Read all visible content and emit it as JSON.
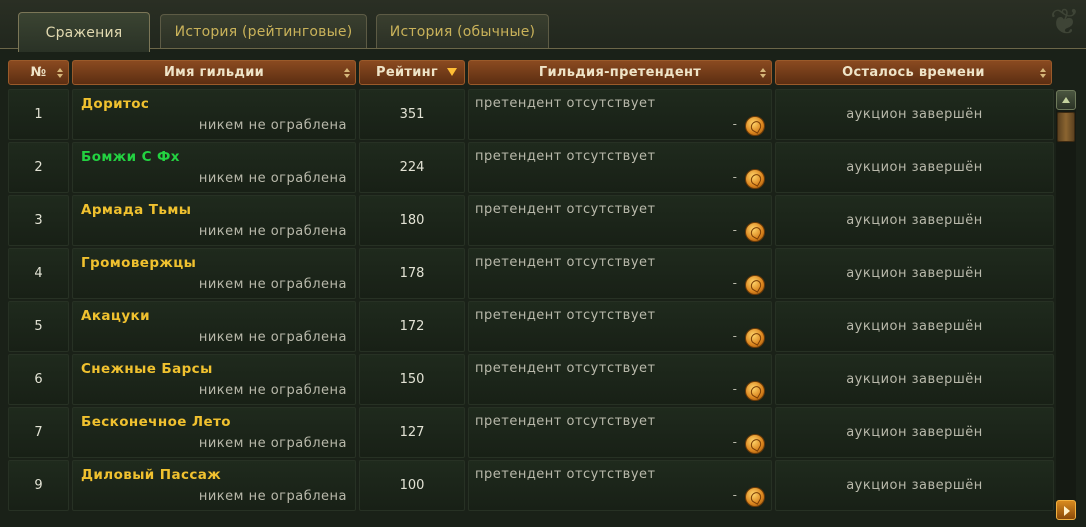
{
  "tabs": [
    {
      "label": "Сражения",
      "active": true
    },
    {
      "label": "История (рейтинговые)",
      "active": false
    },
    {
      "label": "История (обычные)",
      "active": false
    }
  ],
  "columns": {
    "num": "№",
    "guild": "Имя гильдии",
    "rating": "Рейтинг",
    "pretender": "Гильдия-претендент",
    "time_left": "Осталось времени"
  },
  "colors": {
    "guild_default": "#f0c12f",
    "guild_highlight": "#23d241"
  },
  "rows": [
    {
      "num": "1",
      "guild": "Доритос",
      "robbed": "никем не ограблена",
      "rating": "351",
      "pretender": "претендент отсутствует",
      "dash": "-",
      "time_left": "аукцион завершён",
      "highlight": false
    },
    {
      "num": "2",
      "guild": "Бомжи С Фх",
      "robbed": "никем не ограблена",
      "rating": "224",
      "pretender": "претендент отсутствует",
      "dash": "-",
      "time_left": "аукцион завершён",
      "highlight": true
    },
    {
      "num": "3",
      "guild": "Армада Тьмы",
      "robbed": "никем не ограблена",
      "rating": "180",
      "pretender": "претендент отсутствует",
      "dash": "-",
      "time_left": "аукцион завершён",
      "highlight": false
    },
    {
      "num": "4",
      "guild": "Громовержцы",
      "robbed": "никем не ограблена",
      "rating": "178",
      "pretender": "претендент отсутствует",
      "dash": "-",
      "time_left": "аукцион завершён",
      "highlight": false
    },
    {
      "num": "5",
      "guild": "Акацуки",
      "robbed": "никем не ограблена",
      "rating": "172",
      "pretender": "претендент отсутствует",
      "dash": "-",
      "time_left": "аукцион завершён",
      "highlight": false
    },
    {
      "num": "6",
      "guild": "Снежные Барсы",
      "robbed": "никем не ограблена",
      "rating": "150",
      "pretender": "претендент отсутствует",
      "dash": "-",
      "time_left": "аукцион завершён",
      "highlight": false
    },
    {
      "num": "7",
      "guild": "Бесконечное Лето",
      "robbed": "никем не ограблена",
      "rating": "127",
      "pretender": "претендент отсутствует",
      "dash": "-",
      "time_left": "аукцион завершён",
      "highlight": false
    },
    {
      "num": "9",
      "guild": "Диловый Пассаж",
      "robbed": "никем не ограблена",
      "rating": "100",
      "pretender": "претендент отсутствует",
      "dash": "-",
      "time_left": "аукцион завершён",
      "highlight": false
    }
  ]
}
